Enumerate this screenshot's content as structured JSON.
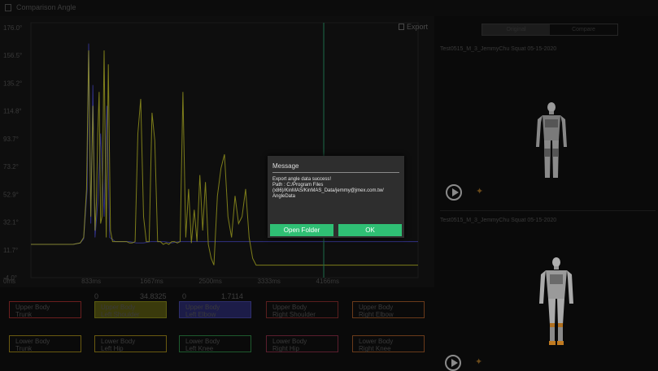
{
  "window": {
    "title": "Comparison Angle"
  },
  "toolbar": {
    "export_label": "Export"
  },
  "colors": {
    "accent_green": "#2fbf74",
    "series_yellow": "#9a9a1e",
    "series_blue": "#3a3aa0",
    "cursor_line": "#1e6b4a"
  },
  "chart_data": {
    "type": "line",
    "xlabel": "",
    "ylabel": "",
    "xlim": [
      0,
      5500
    ],
    "ylim": [
      -4,
      180
    ],
    "grid": false,
    "y_ticks": [
      "176.0°",
      "156.5°",
      "135.2°",
      "114.8°",
      "93.7°",
      "73.2°",
      "52.9°",
      "32.1°",
      "11.7°",
      "-4.0°"
    ],
    "x_ticks": [
      "0ms",
      "833ms",
      "1667ms",
      "2500ms",
      "3333ms",
      "4166ms"
    ],
    "cursor_x_ms": 4160,
    "series": [
      {
        "color": "#9a9a1e",
        "x": [
          0,
          600,
          700,
          750,
          790,
          820,
          850,
          880,
          910,
          930,
          950,
          970,
          990,
          1010,
          1040,
          1070,
          1100,
          1130,
          1160,
          1200,
          1240,
          1280,
          1320,
          1360,
          1400,
          1440,
          1480,
          1520,
          1560,
          1600,
          1640,
          1680,
          1720,
          1760,
          1800,
          1840,
          1880,
          1920,
          1960,
          2000,
          2040,
          2080,
          2120,
          2160,
          2200,
          2240,
          2280,
          2320,
          2360,
          2400,
          2440,
          2480,
          2520,
          2560,
          2600,
          2650,
          2700,
          2750,
          2800,
          2850,
          2900,
          2950,
          3000,
          3050,
          3100,
          3150,
          3200,
          3300,
          3400,
          3500,
          3600,
          3700,
          3800,
          3900,
          4000,
          4100,
          4200,
          4300,
          4400,
          4500,
          4600,
          4700,
          4800,
          4900,
          5000,
          5100,
          5200,
          5300,
          5400,
          5500
        ],
        "y": [
          20,
          20,
          21,
          25,
          60,
          160,
          40,
          120,
          30,
          50,
          100,
          130,
          35,
          40,
          160,
          25,
          150,
          30,
          22,
          22,
          22,
          22,
          22,
          22,
          21,
          21,
          22,
          100,
          125,
          40,
          22,
          22,
          115,
          95,
          22,
          22,
          20,
          21,
          20,
          22,
          22,
          21,
          22,
          130,
          25,
          60,
          21,
          45,
          22,
          70,
          30,
          65,
          20,
          10,
          5,
          55,
          75,
          85,
          40,
          25,
          55,
          35,
          40,
          60,
          25,
          10,
          5,
          5,
          5,
          5,
          5,
          5,
          5,
          5,
          5,
          5,
          5,
          5,
          5,
          5,
          5,
          5,
          5,
          5,
          5,
          5,
          5,
          5,
          5,
          5
        ]
      },
      {
        "color": "#3a3aa0",
        "x": [
          0,
          600,
          700,
          750,
          800,
          820,
          850,
          880,
          910,
          950,
          990,
          1040,
          1080,
          1120,
          1200,
          1300,
          1400,
          1500,
          1600,
          1700,
          1800,
          1900,
          2000,
          2100,
          2200,
          2300,
          2400,
          2500,
          2600,
          2700,
          2800,
          2900,
          3000,
          3100,
          3200,
          3300,
          3400,
          3500,
          3600,
          3700,
          3800,
          3900,
          4000,
          4100,
          4200,
          4300,
          4400,
          4500,
          4600,
          4700,
          4800,
          4900,
          5000,
          5100,
          5200,
          5300,
          5400,
          5500
        ],
        "y": [
          20,
          20,
          21,
          24,
          60,
          165,
          35,
          135,
          25,
          50,
          100,
          40,
          120,
          25,
          22,
          22,
          22,
          21,
          21,
          22,
          22,
          22,
          21,
          22,
          22,
          22,
          22,
          22,
          22,
          22,
          22,
          22,
          22,
          22,
          22,
          22,
          22,
          22,
          22,
          22,
          22,
          22,
          22,
          22,
          22,
          22,
          22,
          22,
          22,
          22,
          22,
          22,
          22,
          22,
          22,
          22,
          22,
          22
        ]
      }
    ]
  },
  "values": {
    "v1": "0",
    "v2": "34.8325",
    "v3": "0",
    "v4": "1.7114"
  },
  "joints": {
    "row1": [
      {
        "l1": "Upper Body",
        "l2": "Trunk"
      },
      {
        "l1": "Upper Body",
        "l2": "Left Shoulder"
      },
      {
        "l1": "Upper Body",
        "l2": "Left Elbow"
      },
      {
        "l1": "Upper Body",
        "l2": "Right Shoulder"
      },
      {
        "l1": "Upper Body",
        "l2": "Right Elbow"
      }
    ],
    "row2": [
      {
        "l1": "Lower Body",
        "l2": "Trunk"
      },
      {
        "l1": "Lower Body",
        "l2": "Left Hip"
      },
      {
        "l1": "Lower Body",
        "l2": "Left Knee"
      },
      {
        "l1": "Lower Body",
        "l2": "Right Hip"
      },
      {
        "l1": "Lower Body",
        "l2": "Right Knee"
      }
    ]
  },
  "right_panel": {
    "tabs": [
      "Original",
      "Compare"
    ],
    "record1": "Test0515_M_3_JemmyChu Squat 05-15-2020",
    "record2": "Test0515_M_3_JemmyChu Squat 05-15-2020"
  },
  "dialog": {
    "title": "Message",
    "body": [
      "Export angle data success!",
      "Path : C:/Program Files",
      "(x86)/KinMAS/KinMAS_Data/jemmy@jmex.com.tw/",
      "AngleData"
    ],
    "btn_open": "Open Folder",
    "btn_ok": "OK"
  }
}
